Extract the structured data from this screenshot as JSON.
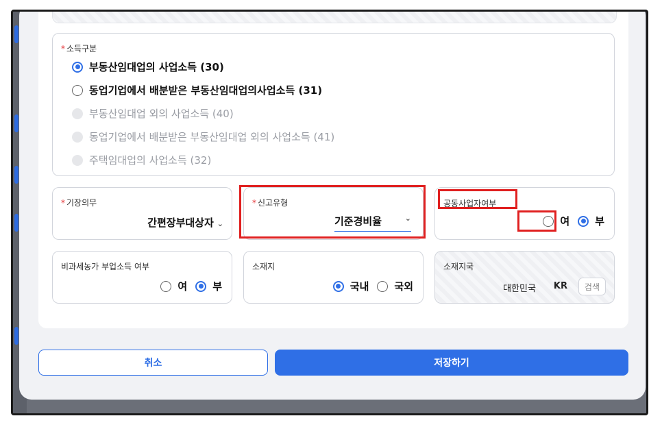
{
  "income_type": {
    "label": "소득구분",
    "options": [
      {
        "label": "부동산임대업의 사업소득 (30)",
        "state": "selected"
      },
      {
        "label": "동업기업에서 배분받은 부동산임대업의사업소득 (31)",
        "state": "enabled"
      },
      {
        "label": "부동산임대업 외의 사업소득 (40)",
        "state": "disabled"
      },
      {
        "label": "동업기업에서 배분받은 부동산임대업 외의 사업소득 (41)",
        "state": "disabled"
      },
      {
        "label": "주택임대업의 사업소득 (32)",
        "state": "disabled"
      }
    ]
  },
  "bookkeeping": {
    "label": "기장의무",
    "value": "간편장부대상자"
  },
  "report_type": {
    "label": "신고유형",
    "value": "기준경비율"
  },
  "joint_business": {
    "label": "공동사업자여부",
    "yes": "여",
    "no": "부",
    "selected": "no"
  },
  "nontax_farm": {
    "label": "비과세농가 부업소득 여부",
    "yes": "여",
    "no": "부",
    "selected": "no"
  },
  "location": {
    "label": "소재지",
    "domestic": "국내",
    "foreign": "국외",
    "selected": "domestic"
  },
  "location_country": {
    "label": "소재지국",
    "name": "대한민국",
    "code": "KR",
    "search_label": "검색"
  },
  "footer": {
    "cancel_label": "취소",
    "save_label": "저장하기"
  },
  "colors": {
    "accent": "#2f6fe6",
    "required": "#e5383b",
    "highlight": "#e02020"
  }
}
